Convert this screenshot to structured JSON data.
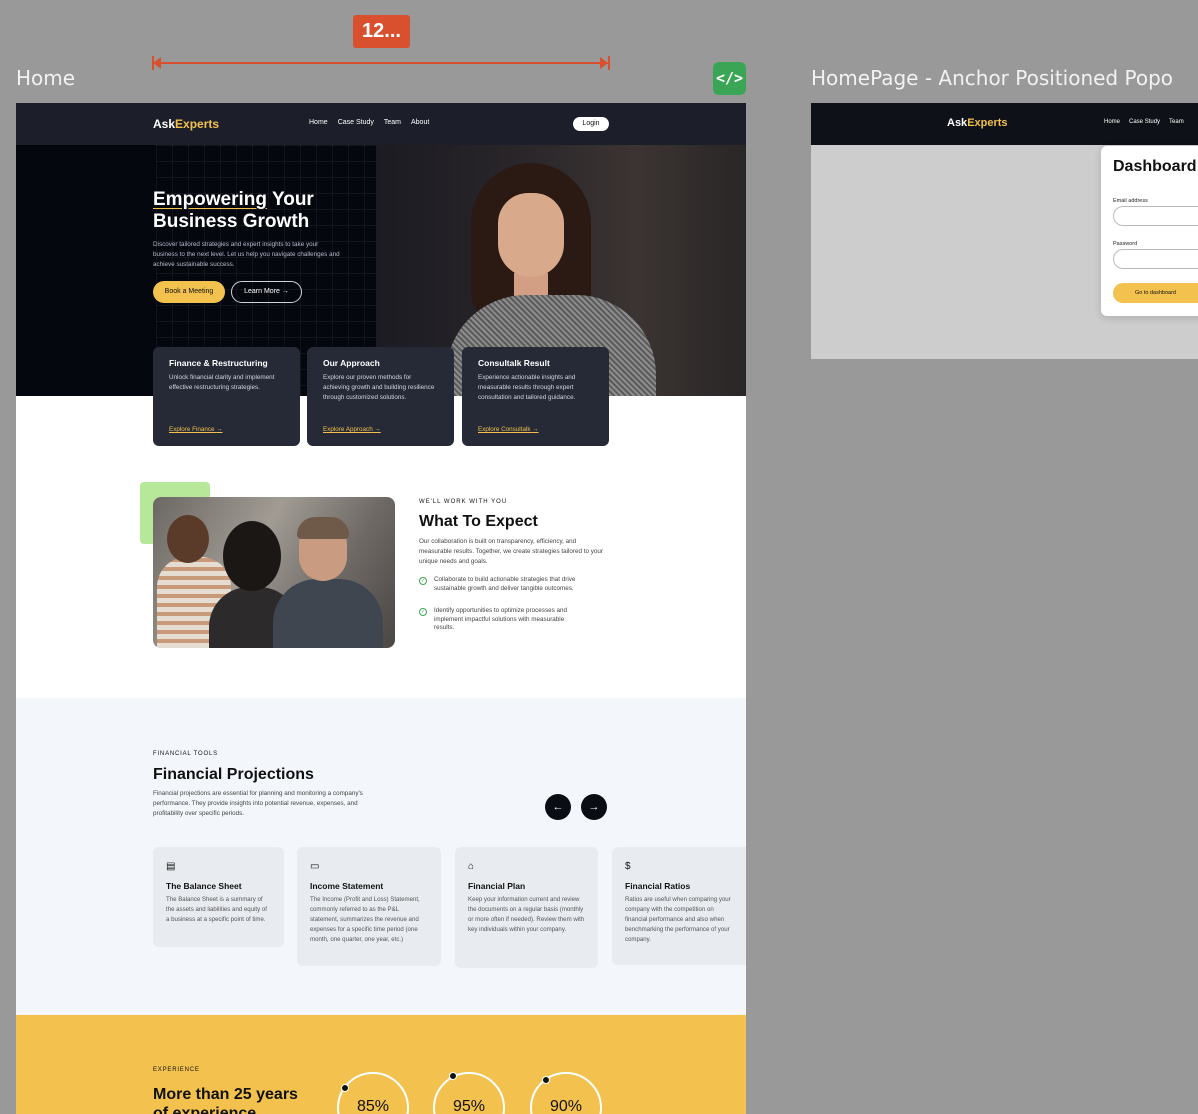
{
  "canvas": {
    "frame1_label": "Home",
    "frame2_label": "HomePage - Anchor Positioned Popo",
    "measure_value": "12...",
    "code_badge": "</>"
  },
  "nav": {
    "logo_part1": "Ask",
    "logo_part2": "Experts",
    "links": [
      "Home",
      "Case Study",
      "Team",
      "About"
    ],
    "login": "Login"
  },
  "hero": {
    "title_line1_a": "Empowering",
    "title_line1_b": "Your",
    "title_line2": "Business Growth",
    "description": "Discover tailored strategies and expert insights to take your business to the next level. Let us help you navigate challenges and achieve sustainable success.",
    "primary_button": "Book a Meeting",
    "secondary_button": "Learn More"
  },
  "services": [
    {
      "title": "Finance & Restructuring",
      "text": "Unlock financial clarity and implement effective restructuring strategies.",
      "link": "Explore Finance"
    },
    {
      "title": "Our Approach",
      "text": "Explore our proven methods for achieving growth and building resilience through customized solutions.",
      "link": "Explore Approach"
    },
    {
      "title": "Consultalk Result",
      "text": "Experience actionable insights and measurable results through expert consultation and tailored guidance.",
      "link": "Explore Consultalk"
    }
  ],
  "expect": {
    "kicker": "WE'LL WORK WITH YOU",
    "title": "What To Expect",
    "description": "Our collaboration is built on transparency, efficiency, and measurable results. Together, we create strategies tailored to your unique needs and goals.",
    "points": [
      "Collaborate to build actionable strategies that drive sustainable growth and deliver tangible outcomes.",
      "Identify opportunities to optimize processes and implement impactful solutions with measurable results."
    ]
  },
  "tools": {
    "kicker": "FINANCIAL TOOLS",
    "title": "Financial Projections",
    "description": "Financial projections are essential for planning and monitoring a company's performance. They provide insights into potential revenue, expenses, and profitability over specific periods.",
    "cards": [
      {
        "icon": "table-icon",
        "title": "The Balance Sheet",
        "text": "The Balance Sheet is a summary of the assets and liabilities and equity of a business at a specific point of time."
      },
      {
        "icon": "card-icon",
        "title": "Income Statement",
        "text": "The Income (Profit and Loss) Statement, commonly referred to as the P&L statement, summarizes the revenue and expenses for a specific time period (one month, one quarter, one year, etc.)"
      },
      {
        "icon": "bank-icon",
        "title": "Financial Plan",
        "text": "Keep your information current and review the documents on a regular basis (monthly or more often if needed). Review them with key individuals within your company."
      },
      {
        "icon": "dollar-icon",
        "title": "Financial Ratios",
        "text": "Ratios are useful when comparing your company with the competition on financial performance and also when benchmarking the performance of your company."
      }
    ]
  },
  "experience": {
    "kicker": "EXPERIENCE",
    "title_line1": "More than 25 years",
    "title_line2": "of experience",
    "stats": [
      "85%",
      "95%",
      "90%"
    ]
  },
  "popover": {
    "nav_links": [
      "Home",
      "Case Study",
      "Team"
    ],
    "title": "Dashboard",
    "email_label": "Email address",
    "password_label": "Password",
    "button": "Go to dashboard"
  },
  "colors": {
    "accent": "#f2c14e",
    "dark": "#1c1f29",
    "green": "#3aa655",
    "measure": "#d9502e"
  }
}
